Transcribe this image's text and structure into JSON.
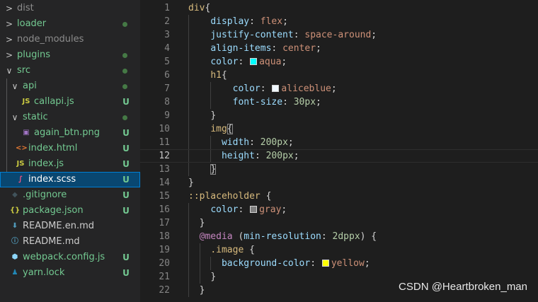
{
  "explorer": {
    "items": [
      {
        "name": "dist",
        "chevron": ">",
        "icon": "",
        "color": "#8c8c8c",
        "status": ""
      },
      {
        "name": "loader",
        "chevron": ">",
        "icon": "",
        "color": "#73c991",
        "status": "dot"
      },
      {
        "name": "node_modules",
        "chevron": ">",
        "icon": "",
        "color": "#8c8c8c",
        "status": ""
      },
      {
        "name": "plugins",
        "chevron": ">",
        "icon": "",
        "color": "#73c991",
        "status": "dot"
      },
      {
        "name": "src",
        "chevron": "∨",
        "icon": "",
        "color": "#73c991",
        "status": "dot"
      },
      {
        "name": "api",
        "chevron": "∨",
        "icon": "",
        "color": "#73c991",
        "status": "dot"
      },
      {
        "name": "callapi.js",
        "chevron": "",
        "icon": "JS",
        "color": "#73c991",
        "status": "U"
      },
      {
        "name": "static",
        "chevron": "∨",
        "icon": "",
        "color": "#73c991",
        "status": "dot"
      },
      {
        "name": "again_btn.png",
        "chevron": "",
        "icon": "▣",
        "color": "#73c991",
        "status": "U"
      },
      {
        "name": "index.html",
        "chevron": "",
        "icon": "<>",
        "color": "#73c991",
        "status": "U"
      },
      {
        "name": "index.js",
        "chevron": "",
        "icon": "JS",
        "color": "#73c991",
        "status": "U"
      },
      {
        "name": "index.scss",
        "chevron": "",
        "icon": "∫",
        "color": "#ffffff",
        "status": "U"
      },
      {
        "name": ".gitignore",
        "chevron": "",
        "icon": "◆",
        "color": "#73c991",
        "status": "U"
      },
      {
        "name": "package.json",
        "chevron": "",
        "icon": "{}",
        "color": "#73c991",
        "status": "U"
      },
      {
        "name": "README.en.md",
        "chevron": "",
        "icon": "⬇",
        "color": "#cccccc",
        "status": ""
      },
      {
        "name": "README.md",
        "chevron": "",
        "icon": "ⓘ",
        "color": "#cccccc",
        "status": ""
      },
      {
        "name": "webpack.config.js",
        "chevron": "",
        "icon": "⬢",
        "color": "#73c991",
        "status": "U"
      },
      {
        "name": "yarn.lock",
        "chevron": "",
        "icon": "♟",
        "color": "#73c991",
        "status": "U"
      }
    ]
  },
  "editor": {
    "lines": [
      {
        "n": "1",
        "tokens": [
          [
            "sel",
            "div"
          ],
          [
            "punc",
            "{"
          ]
        ]
      },
      {
        "n": "2",
        "tokens": [
          [
            "ws",
            "    "
          ],
          [
            "prop",
            "display"
          ],
          [
            "punc",
            ": "
          ],
          [
            "val",
            "flex"
          ],
          [
            "punc",
            ";"
          ]
        ]
      },
      {
        "n": "3",
        "tokens": [
          [
            "ws",
            "    "
          ],
          [
            "prop",
            "justify-content"
          ],
          [
            "punc",
            ": "
          ],
          [
            "val",
            "space-around"
          ],
          [
            "punc",
            ";"
          ]
        ]
      },
      {
        "n": "4",
        "tokens": [
          [
            "ws",
            "    "
          ],
          [
            "prop",
            "align-items"
          ],
          [
            "punc",
            ": "
          ],
          [
            "val",
            "center"
          ],
          [
            "punc",
            ";"
          ]
        ]
      },
      {
        "n": "5",
        "tokens": [
          [
            "ws",
            "    "
          ],
          [
            "prop",
            "color"
          ],
          [
            "punc",
            ": "
          ],
          [
            "swatch",
            "#00ffff"
          ],
          [
            "val",
            "aqua"
          ],
          [
            "punc",
            ";"
          ]
        ]
      },
      {
        "n": "6",
        "tokens": [
          [
            "ws",
            "    "
          ],
          [
            "sel",
            "h1"
          ],
          [
            "punc",
            "{"
          ]
        ]
      },
      {
        "n": "7",
        "tokens": [
          [
            "ws",
            "        "
          ],
          [
            "prop",
            "color"
          ],
          [
            "punc",
            ": "
          ],
          [
            "swatch",
            "#f0f8ff"
          ],
          [
            "val",
            "aliceblue"
          ],
          [
            "punc",
            ";"
          ]
        ]
      },
      {
        "n": "8",
        "tokens": [
          [
            "ws",
            "        "
          ],
          [
            "prop",
            "font-size"
          ],
          [
            "punc",
            ": "
          ],
          [
            "num",
            "30px"
          ],
          [
            "punc",
            ";"
          ]
        ]
      },
      {
        "n": "9",
        "tokens": [
          [
            "ws",
            "    "
          ],
          [
            "punc",
            "}"
          ]
        ]
      },
      {
        "n": "10",
        "tokens": [
          [
            "ws",
            "    "
          ],
          [
            "sel",
            "img"
          ],
          [
            "box",
            "{"
          ]
        ]
      },
      {
        "n": "11",
        "tokens": [
          [
            "ws",
            "      "
          ],
          [
            "prop",
            "width"
          ],
          [
            "punc",
            ": "
          ],
          [
            "num",
            "200px"
          ],
          [
            "punc",
            ";"
          ]
        ]
      },
      {
        "n": "12",
        "tokens": [
          [
            "ws",
            "      "
          ],
          [
            "prop",
            "height"
          ],
          [
            "punc",
            ": "
          ],
          [
            "num",
            "200px"
          ],
          [
            "punc",
            ";"
          ]
        ],
        "current": true
      },
      {
        "n": "13",
        "tokens": [
          [
            "ws",
            "    "
          ],
          [
            "box",
            "}"
          ]
        ]
      },
      {
        "n": "14",
        "tokens": [
          [
            "punc",
            "}"
          ]
        ]
      },
      {
        "n": "15",
        "tokens": [
          [
            "sel",
            "::placeholder"
          ],
          [
            "punc",
            " {"
          ]
        ]
      },
      {
        "n": "16",
        "tokens": [
          [
            "ws",
            "    "
          ],
          [
            "prop",
            "color"
          ],
          [
            "punc",
            ": "
          ],
          [
            "swatch",
            "#808080"
          ],
          [
            "val",
            "gray"
          ],
          [
            "punc",
            ";"
          ]
        ]
      },
      {
        "n": "17",
        "tokens": [
          [
            "ws",
            "  "
          ],
          [
            "punc",
            "}"
          ]
        ]
      },
      {
        "n": "18",
        "tokens": [
          [
            "ws",
            "  "
          ],
          [
            "at",
            "@media"
          ],
          [
            "punc",
            " ("
          ],
          [
            "prop",
            "min-resolution"
          ],
          [
            "punc",
            ": "
          ],
          [
            "num",
            "2dppx"
          ],
          [
            "punc",
            ") {"
          ]
        ]
      },
      {
        "n": "19",
        "tokens": [
          [
            "ws",
            "    "
          ],
          [
            "sel",
            ".image"
          ],
          [
            "punc",
            " {"
          ]
        ]
      },
      {
        "n": "20",
        "tokens": [
          [
            "ws",
            "      "
          ],
          [
            "prop",
            "background-color"
          ],
          [
            "punc",
            ": "
          ],
          [
            "swatch",
            "#ffff00"
          ],
          [
            "val",
            "yellow"
          ],
          [
            "punc",
            ";"
          ]
        ]
      },
      {
        "n": "21",
        "tokens": [
          [
            "ws",
            "    "
          ],
          [
            "punc",
            "}"
          ]
        ]
      },
      {
        "n": "22",
        "tokens": [
          [
            "ws",
            "  "
          ],
          [
            "punc",
            "}"
          ]
        ]
      }
    ]
  },
  "watermark": "CSDN @Heartbroken_man",
  "colors": {
    "sidebar_bg": "#252526",
    "editor_bg": "#1e1e1e",
    "selection_bg": "#094771",
    "git_untracked": "#73c991"
  }
}
